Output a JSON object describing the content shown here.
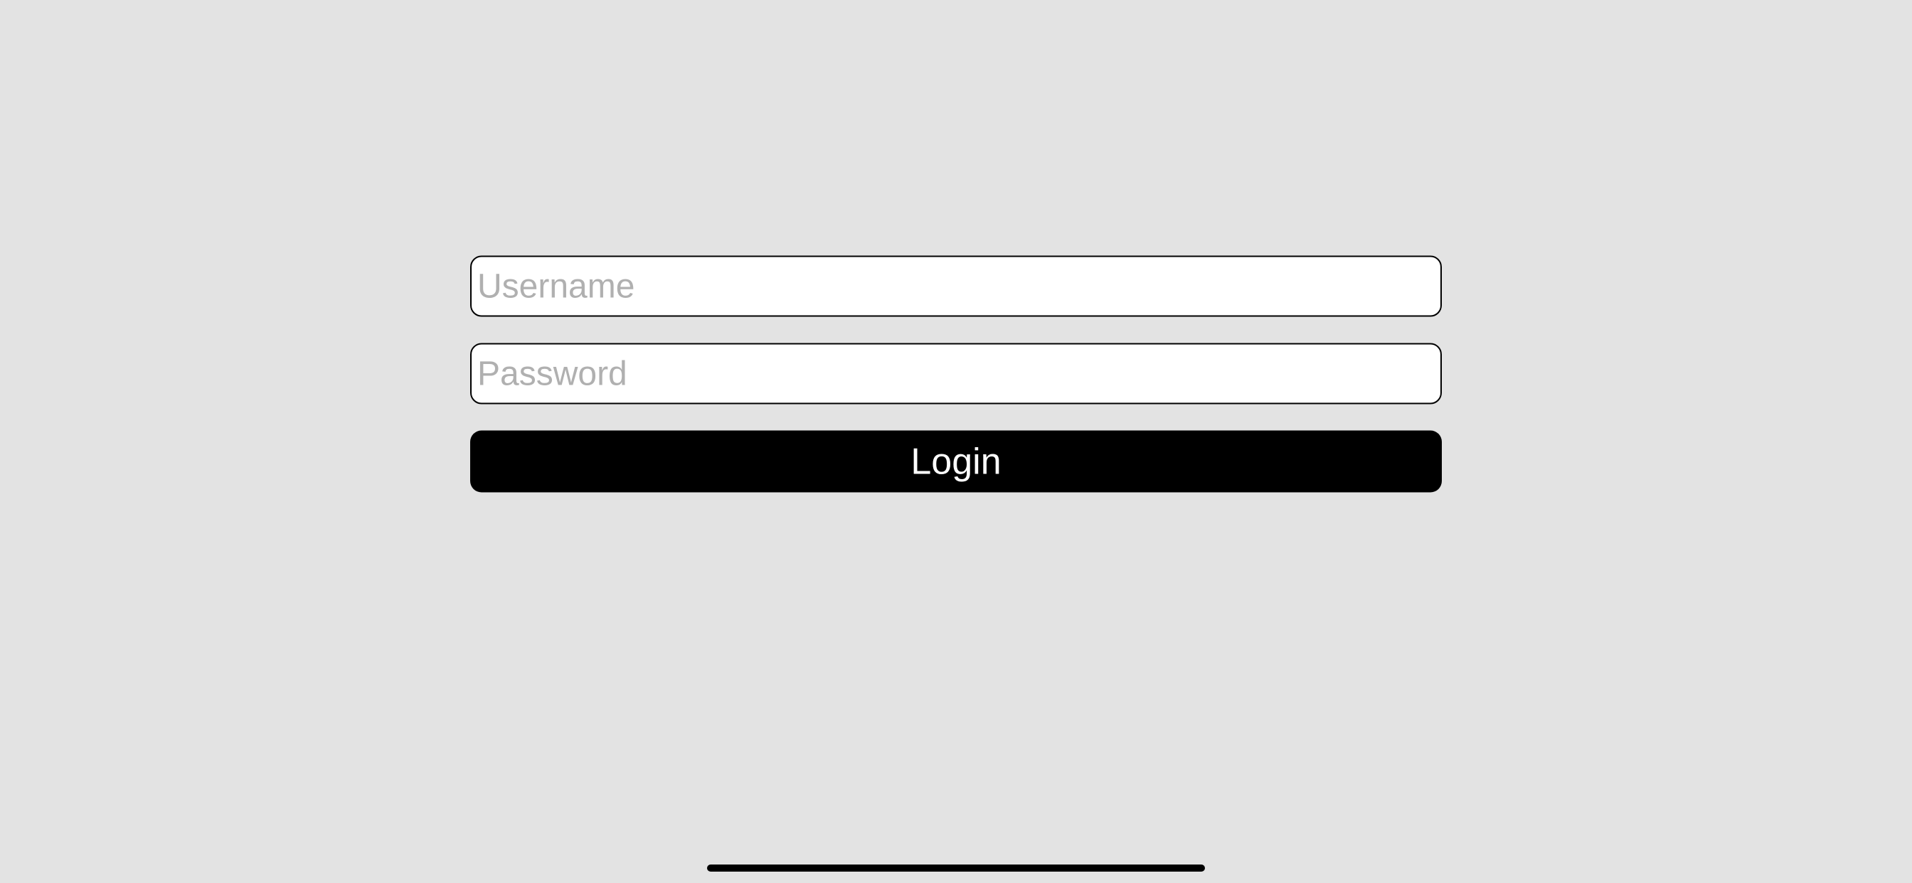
{
  "login": {
    "username_placeholder": "Username",
    "username_value": "",
    "password_placeholder": "Password",
    "password_value": "",
    "login_button_label": "Login"
  }
}
